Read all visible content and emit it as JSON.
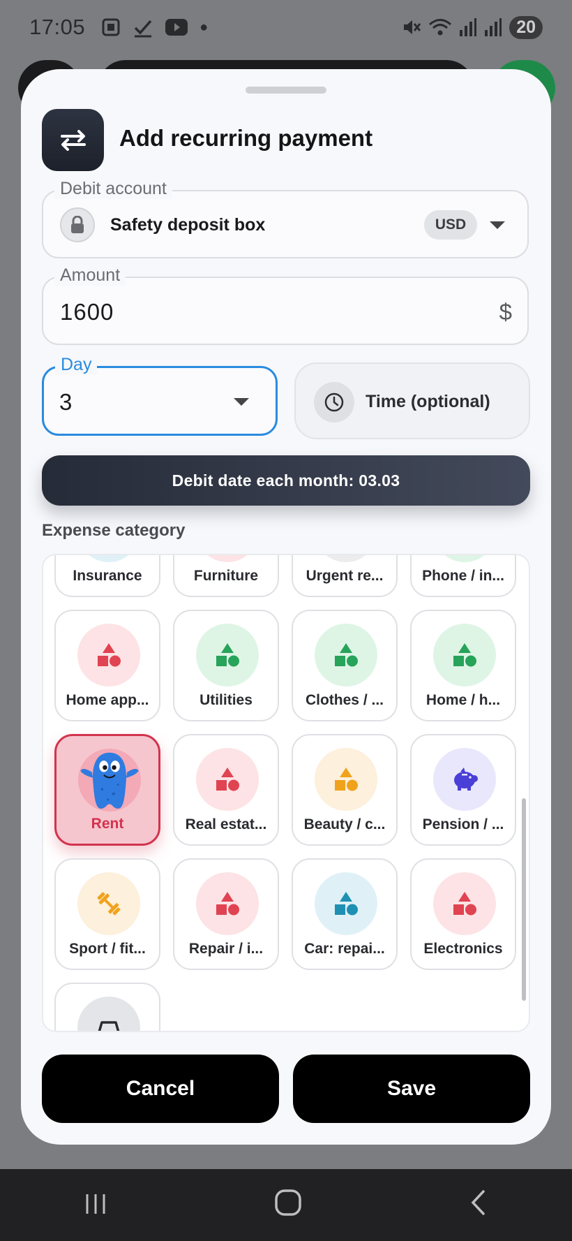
{
  "status_bar": {
    "time": "17:05",
    "battery": "20"
  },
  "sheet": {
    "title": "Add recurring payment",
    "debit_account": {
      "legend": "Debit account",
      "name": "Safety deposit box",
      "currency": "USD"
    },
    "amount": {
      "legend": "Amount",
      "value": "1600",
      "suffix": "$"
    },
    "day": {
      "legend": "Day",
      "value": "3"
    },
    "time_button": {
      "label": "Time (optional)"
    },
    "debit_date_banner": "Debit date each month: 03.03",
    "expense_category": {
      "title": "Expense category",
      "tiles": [
        {
          "label": "Insurance",
          "icon": "shapes-icon",
          "color": "#2b9fc8",
          "bg": "#dff1f7"
        },
        {
          "label": "Furniture",
          "icon": "shapes-icon",
          "color": "#e04351",
          "bg": "#fde3e5"
        },
        {
          "label": "Urgent re...",
          "icon": "shapes-icon",
          "color": "#8a8b90",
          "bg": "#ececee"
        },
        {
          "label": "Phone / in...",
          "icon": "shapes-icon",
          "color": "#27a35a",
          "bg": "#def5e6"
        },
        {
          "label": "Home app...",
          "icon": "shapes-icon",
          "color": "#e04351",
          "bg": "#fde3e5"
        },
        {
          "label": "Utilities",
          "icon": "shapes-icon",
          "color": "#27a35a",
          "bg": "#def5e6"
        },
        {
          "label": "Clothes / ...",
          "icon": "shapes-icon",
          "color": "#27a35a",
          "bg": "#def5e6"
        },
        {
          "label": "Home / h...",
          "icon": "shapes-icon",
          "color": "#27a35a",
          "bg": "#def5e6"
        },
        {
          "label": "Rent",
          "icon": "mascot-icon",
          "color": "#2f7be0",
          "bg": "#f3a9b6",
          "selected": true
        },
        {
          "label": "Real estat...",
          "icon": "shapes-icon",
          "color": "#e04351",
          "bg": "#fde3e5"
        },
        {
          "label": "Beauty / c...",
          "icon": "shapes-icon",
          "color": "#f0a21c",
          "bg": "#fdf0dc"
        },
        {
          "label": "Pension / ...",
          "icon": "piggy-bank-icon",
          "color": "#4a3fd6",
          "bg": "#e9e7fc"
        },
        {
          "label": "Sport / fit...",
          "icon": "dumbbell-icon",
          "color": "#f0a21c",
          "bg": "#fdf0dc"
        },
        {
          "label": "Repair / i...",
          "icon": "shapes-icon",
          "color": "#e04351",
          "bg": "#fde3e5"
        },
        {
          "label": "Car: repai...",
          "icon": "shapes-icon",
          "color": "#1f8fb4",
          "bg": "#dff1f7"
        },
        {
          "label": "Electronics",
          "icon": "shapes-icon",
          "color": "#e04351",
          "bg": "#fde3e5"
        },
        {
          "label": "",
          "icon": "car-icon",
          "color": "#2a2b2f",
          "bg": "#e4e5e8"
        }
      ]
    },
    "buttons": {
      "cancel": "Cancel",
      "save": "Save"
    }
  },
  "colors": {
    "accent_blue": "#2a8bdf",
    "selected_red": "#d2334d",
    "dark_button": "#000000"
  }
}
